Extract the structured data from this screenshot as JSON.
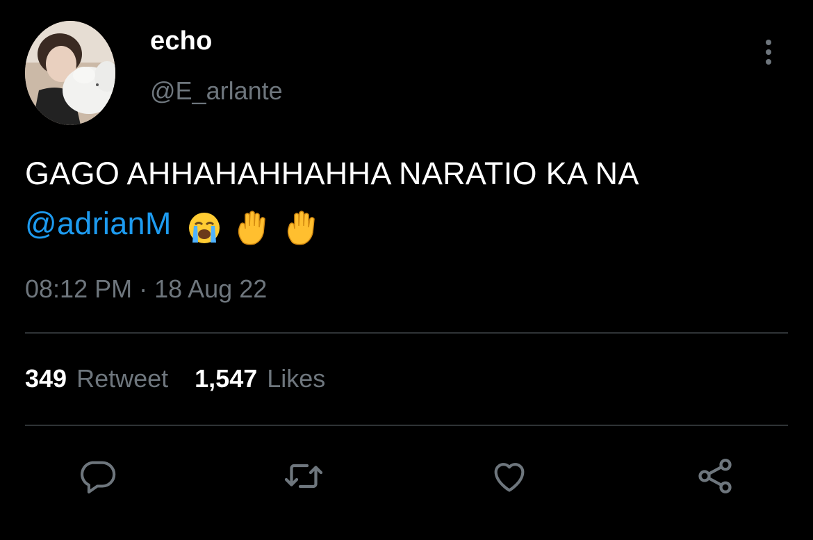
{
  "tweet": {
    "author": {
      "display_name": "echo",
      "handle": "@E_arlante"
    },
    "text": {
      "line1": "GAGO AHHAHAHHAHHA NARATIO KA NA",
      "mention": "@adrianM"
    },
    "timestamp": "08:12 PM · 18 Aug 22",
    "stats": {
      "retweets_count": "349",
      "retweets_label": "Retweet",
      "likes_count": "1,547",
      "likes_label": "Likes"
    }
  },
  "icons": {
    "more": "vertical-ellipsis-icon",
    "reply": "reply-icon",
    "retweet": "retweet-icon",
    "like": "heart-icon",
    "share": "share-icon",
    "emojis": [
      "loudly-crying-face-icon",
      "raised-hand-icon",
      "raised-hand-icon"
    ]
  },
  "colors": {
    "background": "#000000",
    "text_primary": "#ffffff",
    "text_secondary": "#6e767d",
    "mention": "#1d9bf0",
    "divider": "#2f3336",
    "icon": "#6e767d"
  }
}
